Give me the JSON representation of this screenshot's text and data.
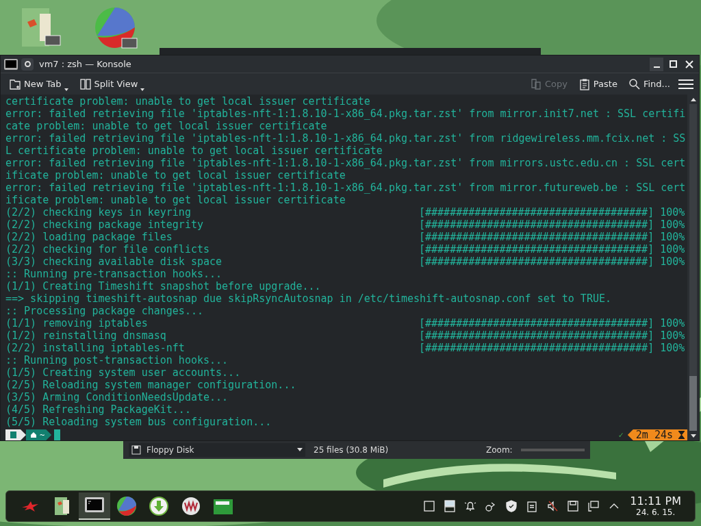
{
  "window": {
    "title": "vm7 : zsh — Konsole"
  },
  "toolbar": [
    {
      "kind": "new-tab",
      "label": "New Tab",
      "menu": true,
      "disabled": false
    },
    {
      "kind": "split-view",
      "label": "Split View",
      "menu": true,
      "disabled": false
    },
    {
      "kind": "copy",
      "label": "Copy",
      "menu": false,
      "disabled": true
    },
    {
      "kind": "paste",
      "label": "Paste",
      "menu": false,
      "disabled": false
    },
    {
      "kind": "find",
      "label": "Find...",
      "menu": false,
      "disabled": false
    }
  ],
  "terminal": {
    "lines": [
      {
        "kind": "text",
        "text": "certificate problem: unable to get local issuer certificate"
      },
      {
        "kind": "text",
        "text": "error: failed retrieving file 'iptables-nft-1:1.8.10-1-x86_64.pkg.tar.zst' from mirror.init7.net : SSL certifi"
      },
      {
        "kind": "text",
        "text": "cate problem: unable to get local issuer certificate"
      },
      {
        "kind": "text",
        "text": "error: failed retrieving file 'iptables-nft-1:1.8.10-1-x86_64.pkg.tar.zst' from ridgewireless.mm.fcix.net : SS"
      },
      {
        "kind": "text",
        "text": "L certificate problem: unable to get local issuer certificate"
      },
      {
        "kind": "text",
        "text": "error: failed retrieving file 'iptables-nft-1:1.8.10-1-x86_64.pkg.tar.zst' from mirrors.ustc.edu.cn : SSL cert"
      },
      {
        "kind": "text",
        "text": "ificate problem: unable to get local issuer certificate"
      },
      {
        "kind": "text",
        "text": "error: failed retrieving file 'iptables-nft-1:1.8.10-1-x86_64.pkg.tar.zst' from mirror.futureweb.be : SSL cert"
      },
      {
        "kind": "text",
        "text": "ificate problem: unable to get local issuer certificate"
      },
      {
        "kind": "progress",
        "text": "(2/2) checking keys in keyring",
        "bar": "[####################################]",
        "percent": "100%"
      },
      {
        "kind": "progress",
        "text": "(2/2) checking package integrity",
        "bar": "[####################################]",
        "percent": "100%"
      },
      {
        "kind": "progress",
        "text": "(2/2) loading package files",
        "bar": "[####################################]",
        "percent": "100%"
      },
      {
        "kind": "progress",
        "text": "(2/2) checking for file conflicts",
        "bar": "[####################################]",
        "percent": "100%"
      },
      {
        "kind": "progress",
        "text": "(3/3) checking available disk space",
        "bar": "[####################################]",
        "percent": "100%"
      },
      {
        "kind": "text",
        "text": ":: Running pre-transaction hooks..."
      },
      {
        "kind": "text",
        "text": "(1/1) Creating Timeshift snapshot before upgrade..."
      },
      {
        "kind": "text",
        "text": "==> skipping timeshift-autosnap due skipRsyncAutosnap in /etc/timeshift-autosnap.conf set to TRUE."
      },
      {
        "kind": "text",
        "text": ":: Processing package changes..."
      },
      {
        "kind": "progress",
        "text": "(1/1) removing iptables",
        "bar": "[####################################]",
        "percent": "100%"
      },
      {
        "kind": "progress",
        "text": "(1/2) reinstalling dnsmasq",
        "bar": "[####################################]",
        "percent": "100%"
      },
      {
        "kind": "progress",
        "text": "(2/2) installing iptables-nft",
        "bar": "[####################################]",
        "percent": "100%"
      },
      {
        "kind": "text",
        "text": ":: Running post-transaction hooks..."
      },
      {
        "kind": "text",
        "text": "(1/5) Creating system user accounts..."
      },
      {
        "kind": "text",
        "text": "(2/5) Reloading system manager configuration..."
      },
      {
        "kind": "text",
        "text": "(3/5) Arming ConditionNeedsUpdate..."
      },
      {
        "kind": "text",
        "text": "(4/5) Refreshing PackageKit..."
      },
      {
        "kind": "text",
        "text": "(5/5) Reloading system bus configuration..."
      }
    ],
    "prompt": {
      "path": "~",
      "status": "✓",
      "duration": "2m 24s"
    }
  },
  "background_window": {
    "device": "Floppy Disk",
    "summary": "25 files (30.8 MiB)",
    "zoom_label": "Zoom:"
  },
  "taskbar": {
    "tasks": [
      {
        "kind": "menu",
        "selected": false
      },
      {
        "kind": "folder",
        "selected": false
      },
      {
        "kind": "terminal",
        "selected": true
      },
      {
        "kind": "globe",
        "selected": false
      },
      {
        "kind": "download",
        "selected": false
      },
      {
        "kind": "vm",
        "selected": false
      },
      {
        "kind": "files",
        "selected": false
      }
    ],
    "time": "11:11 PM",
    "date": "24. 6. 15."
  }
}
